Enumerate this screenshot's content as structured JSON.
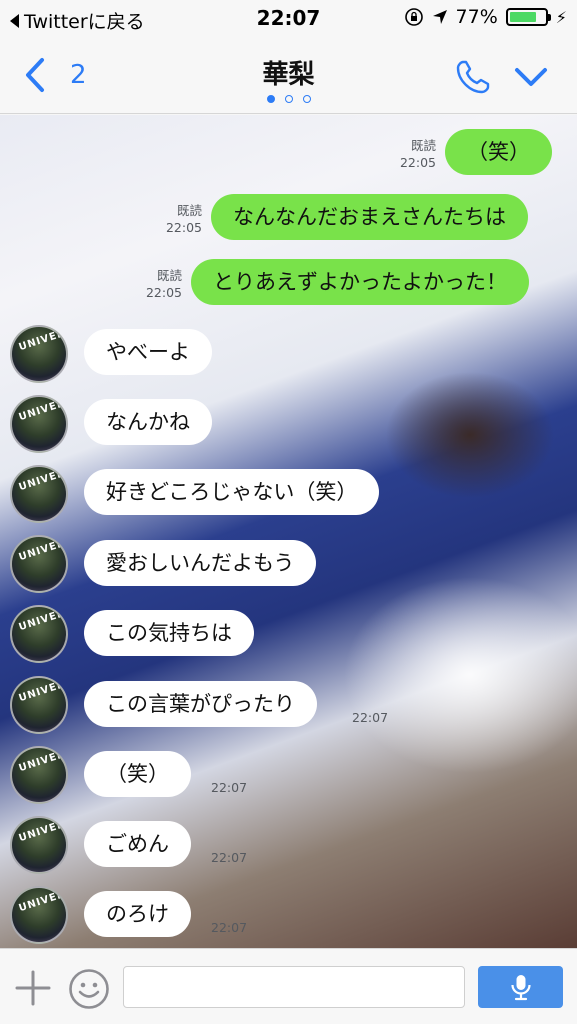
{
  "status_bar": {
    "back_app": "Twitterに戻る",
    "time": "22:07",
    "battery": "77%",
    "battery_level": 0.77,
    "icons": [
      "rotation-lock-icon",
      "location-icon",
      "battery-icon",
      "charging-icon"
    ]
  },
  "nav": {
    "back_count": "2",
    "title": "華梨",
    "page_dots": 3,
    "active_dot": 0,
    "icons": [
      "back-chevron-icon",
      "phone-icon",
      "chevron-down-icon"
    ]
  },
  "messages": [
    {
      "side": "out",
      "text": "（笑）",
      "read": "既読",
      "time": "22:05"
    },
    {
      "side": "out",
      "text": "なんなんだおまえさんたちは",
      "read": "既読",
      "time": "22:05"
    },
    {
      "side": "out",
      "text": "とりあえずよかったよかった！",
      "read": "既読",
      "time": "22:05"
    },
    {
      "side": "in",
      "text": "やべーよ",
      "time": ""
    },
    {
      "side": "in",
      "text": "なんかね",
      "time": ""
    },
    {
      "side": "in",
      "text": "好きどころじゃない（笑）",
      "time": ""
    },
    {
      "side": "in",
      "text": "愛おしいんだよもう",
      "time": ""
    },
    {
      "side": "in",
      "text": "この気持ちは",
      "time": ""
    },
    {
      "side": "in",
      "text": "この言葉がぴったり",
      "time": "22:07"
    },
    {
      "side": "in",
      "text": "（笑）",
      "time": "22:07"
    },
    {
      "side": "in",
      "text": "ごめん",
      "time": "22:07"
    },
    {
      "side": "in",
      "text": "のろけ",
      "time": "22:07"
    }
  ],
  "avatar_label": "UNIVER",
  "input_bar": {
    "placeholder": "",
    "icons": [
      "plus-icon",
      "smile-icon",
      "microphone-icon"
    ]
  },
  "colors": {
    "accent": "#2d7cf6",
    "outgoing_bubble": "#79e24a",
    "incoming_bubble": "#ffffff",
    "battery_fill": "#4cd964",
    "mic_button": "#4a90e8"
  }
}
